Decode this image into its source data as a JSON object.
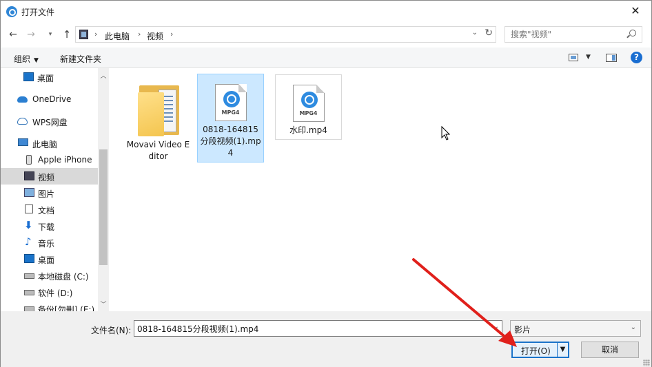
{
  "window": {
    "title": "打开文件",
    "close_glyph": "✕"
  },
  "address": {
    "breadcrumbs": [
      "此电脑",
      "视频"
    ],
    "separator": "›"
  },
  "search": {
    "placeholder": "搜索\"视频\""
  },
  "toolbar": {
    "organize": "组织",
    "new_folder": "新建文件夹",
    "help": "?"
  },
  "sidebar": {
    "items": [
      {
        "label": "桌面",
        "icon": "desktop-icon",
        "state": ""
      },
      {
        "label": "OneDrive",
        "icon": "onedrive-cloud-icon",
        "state": ""
      },
      {
        "label": "WPS网盘",
        "icon": "wps-cloud-icon",
        "state": ""
      },
      {
        "label": "此电脑",
        "icon": "this-pc-icon",
        "state": ""
      },
      {
        "label": "Apple iPhone",
        "icon": "iphone-icon",
        "state": ""
      },
      {
        "label": "视频",
        "icon": "videos-icon",
        "state": "selected"
      },
      {
        "label": "图片",
        "icon": "pictures-icon",
        "state": ""
      },
      {
        "label": "文档",
        "icon": "documents-icon",
        "state": ""
      },
      {
        "label": "下载",
        "icon": "downloads-icon",
        "state": ""
      },
      {
        "label": "音乐",
        "icon": "music-icon",
        "state": ""
      },
      {
        "label": "桌面",
        "icon": "desktop-icon",
        "state": ""
      },
      {
        "label": "本地磁盘 (C:)",
        "icon": "drive-icon",
        "state": ""
      },
      {
        "label": "软件 (D:)",
        "icon": "drive-icon",
        "state": ""
      },
      {
        "label": "备份[勿删] (E:)",
        "icon": "drive-icon",
        "state": ""
      }
    ]
  },
  "files": [
    {
      "name": "Movavi Video Editor",
      "type": "folder",
      "state": ""
    },
    {
      "name": "0818-164815分段视频(1).mp4",
      "type": "mp4",
      "badge": "MPG4",
      "state": "selected"
    },
    {
      "name": "水印.mp4",
      "type": "mp4",
      "badge": "MPG4",
      "state": "focused"
    }
  ],
  "footer": {
    "filename_label": "文件名(N):",
    "filename_value": "0818-164815分段视频(1).mp4",
    "filter_value": "影片",
    "open_button": "打开(O)",
    "cancel_button": "取消"
  },
  "colors": {
    "accent": "#1a73c9",
    "selection": "#cce8ff",
    "annotation_arrow": "#e0201b"
  }
}
